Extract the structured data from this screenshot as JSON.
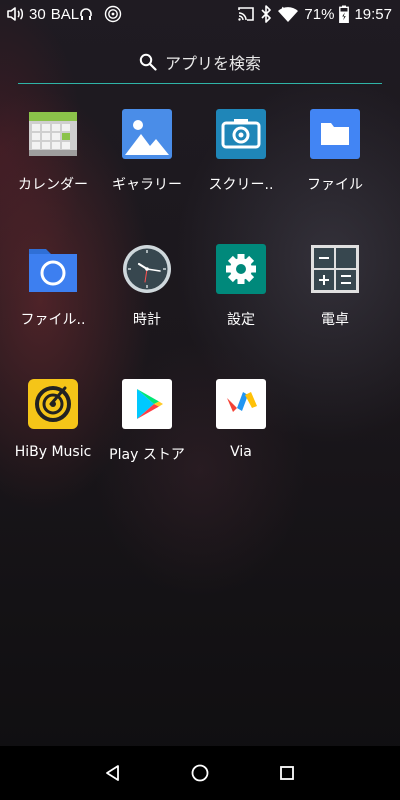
{
  "status_bar": {
    "volume_level": "30",
    "audio_mode": "BAL",
    "battery_percent": "71%",
    "time": "19:57",
    "icons": [
      "volume-icon",
      "headphones-icon",
      "hiby-status-icon",
      "cast-icon",
      "bluetooth-icon",
      "wifi-icon",
      "battery-icon"
    ]
  },
  "search": {
    "placeholder": "アプリを検索",
    "icon": "search-icon"
  },
  "apps": [
    {
      "label": "カレンダー",
      "icon": "calendar-icon"
    },
    {
      "label": "ギャラリー",
      "icon": "gallery-icon"
    },
    {
      "label": "スクリー..",
      "icon": "screenshot-icon"
    },
    {
      "label": "ファイル",
      "icon": "files-icon"
    },
    {
      "label": "ファイル..",
      "icon": "file-manager-icon"
    },
    {
      "label": "時計",
      "icon": "clock-icon"
    },
    {
      "label": "設定",
      "icon": "settings-icon"
    },
    {
      "label": "電卓",
      "icon": "calculator-icon"
    },
    {
      "label": "HiBy Music",
      "icon": "hiby-music-icon"
    },
    {
      "label": "Play ストア",
      "icon": "play-store-icon"
    },
    {
      "label": "Via",
      "icon": "via-browser-icon"
    }
  ],
  "nav_bar": {
    "buttons": [
      "back-icon",
      "home-icon",
      "recents-icon"
    ]
  },
  "colors": {
    "search_underline": "#2fb4a7",
    "nav_bar_bg": "#000000"
  }
}
